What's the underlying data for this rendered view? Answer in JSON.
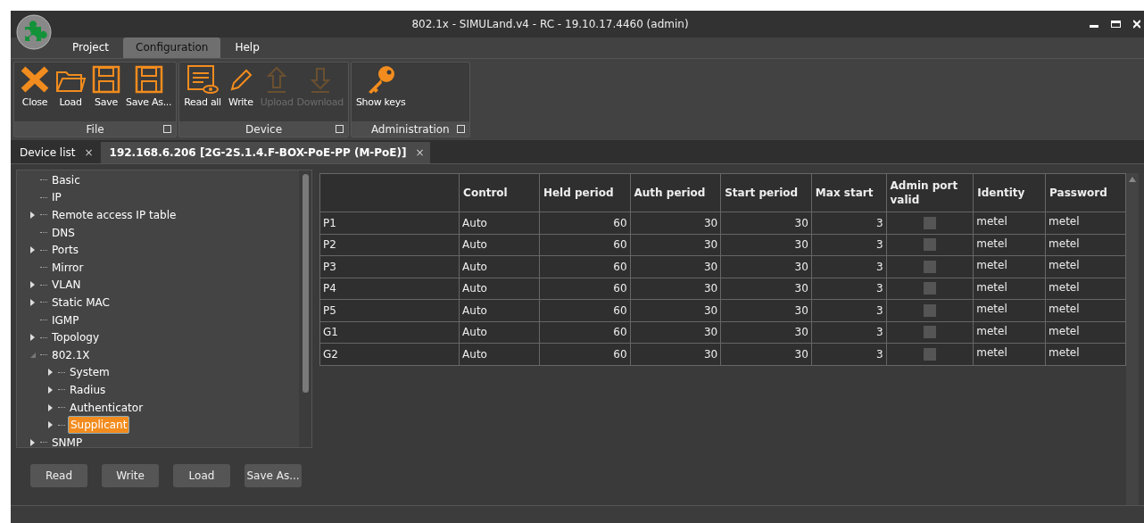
{
  "window": {
    "title": "802.1x - SIMULand.v4 - RC - 19.10.17.4460 (admin)"
  },
  "menu_tabs": [
    {
      "label": "Project",
      "selected": false
    },
    {
      "label": "Configuration",
      "selected": true
    },
    {
      "label": "Help",
      "selected": false
    }
  ],
  "ribbon": [
    {
      "label": "File",
      "buttons": [
        {
          "label": "Close",
          "kind": "close",
          "disabled": false
        },
        {
          "label": "Load",
          "kind": "folder",
          "disabled": false
        },
        {
          "label": "Save",
          "kind": "floppy",
          "disabled": false
        },
        {
          "label": "Save As...",
          "kind": "floppy",
          "disabled": false
        }
      ]
    },
    {
      "label": "Device",
      "buttons": [
        {
          "label": "Read all",
          "kind": "read",
          "disabled": false
        },
        {
          "label": "Write",
          "kind": "pencil",
          "disabled": false
        },
        {
          "label": "Upload",
          "kind": "up",
          "disabled": true
        },
        {
          "label": "Download",
          "kind": "down",
          "disabled": true
        }
      ]
    },
    {
      "label": "Administration",
      "buttons": [
        {
          "label": "Show keys",
          "kind": "key",
          "disabled": false
        }
      ]
    }
  ],
  "doc_tabs": [
    {
      "label": "Device list",
      "close": "×",
      "selected": false
    },
    {
      "label": "192.168.6.206 [2G-2S.1.4.F-BOX-PoE-PP (M-PoE)]",
      "close": "×",
      "selected": true
    }
  ],
  "tree": [
    {
      "label": "Basic",
      "kind": "leaf",
      "selected": false
    },
    {
      "label": "IP",
      "kind": "leaf",
      "selected": false
    },
    {
      "label": "Remote access IP table",
      "kind": "collapsed",
      "selected": false
    },
    {
      "label": "DNS",
      "kind": "leaf",
      "selected": false
    },
    {
      "label": "Ports",
      "kind": "collapsed",
      "selected": false
    },
    {
      "label": "Mirror",
      "kind": "leaf",
      "selected": false
    },
    {
      "label": "VLAN",
      "kind": "collapsed",
      "selected": false
    },
    {
      "label": "Static MAC",
      "kind": "collapsed",
      "selected": false
    },
    {
      "label": "IGMP",
      "kind": "leaf",
      "selected": false
    },
    {
      "label": "Topology",
      "kind": "collapsed",
      "selected": false
    },
    {
      "label": "802.1X",
      "kind": "expanded",
      "selected": false,
      "children": [
        {
          "label": "System",
          "kind": "collapsed",
          "selected": false
        },
        {
          "label": "Radius",
          "kind": "collapsed",
          "selected": false
        },
        {
          "label": "Authenticator",
          "kind": "collapsed",
          "selected": false
        },
        {
          "label": "Supplicant",
          "kind": "collapsed",
          "selected": true
        }
      ]
    },
    {
      "label": "SNMP",
      "kind": "collapsed",
      "selected": false
    }
  ],
  "panel_buttons": [
    "Read",
    "Write",
    "Load",
    "Save As..."
  ],
  "table": {
    "columns": [
      "",
      "Control",
      "Held period",
      "Auth period",
      "Start period",
      "Max start",
      "Admin port valid",
      "Identity",
      "Password"
    ],
    "rows": [
      {
        "port": "P1",
        "control": "Auto",
        "held": "60",
        "auth": "30",
        "start": "30",
        "max": "3",
        "admin_valid": false,
        "identity": "metel",
        "password": "metel"
      },
      {
        "port": "P2",
        "control": "Auto",
        "held": "60",
        "auth": "30",
        "start": "30",
        "max": "3",
        "admin_valid": false,
        "identity": "metel",
        "password": "metel"
      },
      {
        "port": "P3",
        "control": "Auto",
        "held": "60",
        "auth": "30",
        "start": "30",
        "max": "3",
        "admin_valid": false,
        "identity": "metel",
        "password": "metel"
      },
      {
        "port": "P4",
        "control": "Auto",
        "held": "60",
        "auth": "30",
        "start": "30",
        "max": "3",
        "admin_valid": false,
        "identity": "metel",
        "password": "metel"
      },
      {
        "port": "P5",
        "control": "Auto",
        "held": "60",
        "auth": "30",
        "start": "30",
        "max": "3",
        "admin_valid": false,
        "identity": "metel",
        "password": "metel"
      },
      {
        "port": "G1",
        "control": "Auto",
        "held": "60",
        "auth": "30",
        "start": "30",
        "max": "3",
        "admin_valid": false,
        "identity": "metel",
        "password": "metel"
      },
      {
        "port": "G2",
        "control": "Auto",
        "held": "60",
        "auth": "30",
        "start": "30",
        "max": "3",
        "admin_valid": false,
        "identity": "metel",
        "password": "metel"
      }
    ]
  }
}
